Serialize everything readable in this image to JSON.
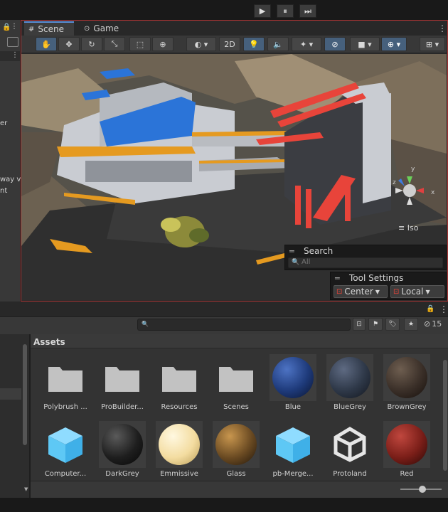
{
  "toolbar": {
    "play": "▶",
    "pause": "⏸",
    "step": "⏭"
  },
  "scene": {
    "tabs": [
      {
        "label": "Scene"
      },
      {
        "label": "Game"
      }
    ],
    "tool_2d": "2D",
    "iso_label": "Iso",
    "gizmo_axes": {
      "y": "y",
      "x": "x",
      "z": "z"
    },
    "search": {
      "title": "Search",
      "placeholder": "All"
    },
    "tool_settings": {
      "title": "Tool Settings",
      "pivot": "Center",
      "space": "Local"
    }
  },
  "left_panel": {
    "fragments": [
      "er",
      "way v",
      "nt"
    ]
  },
  "project": {
    "header": "Assets",
    "hidden_count": "15",
    "assets": [
      {
        "label": "Polybrush ...",
        "kind": "folder"
      },
      {
        "label": "ProBuilder...",
        "kind": "folder"
      },
      {
        "label": "Resources",
        "kind": "folder"
      },
      {
        "label": "Scenes",
        "kind": "folder"
      },
      {
        "label": "Blue",
        "kind": "material",
        "color": "#1e3a7a"
      },
      {
        "label": "BlueGrey",
        "kind": "material",
        "color": "#2e3848"
      },
      {
        "label": "BrownGrey",
        "kind": "material",
        "color": "#3a2f28"
      },
      {
        "label": "Computer...",
        "kind": "prefab"
      },
      {
        "label": "DarkGrey",
        "kind": "material",
        "color": "#1e1e1e"
      },
      {
        "label": "Emmissive",
        "kind": "material",
        "color": "#f3dca0"
      },
      {
        "label": "Glass",
        "kind": "material",
        "color": "#6a4a22"
      },
      {
        "label": "pb-Merge...",
        "kind": "prefab"
      },
      {
        "label": "Protoland",
        "kind": "unity"
      },
      {
        "label": "Red",
        "kind": "material",
        "color": "#7a1e18"
      }
    ]
  },
  "colors": {
    "accent": "#5a8fd8",
    "selection_border": "#aa3333",
    "prefab": "#5ec8f5"
  }
}
